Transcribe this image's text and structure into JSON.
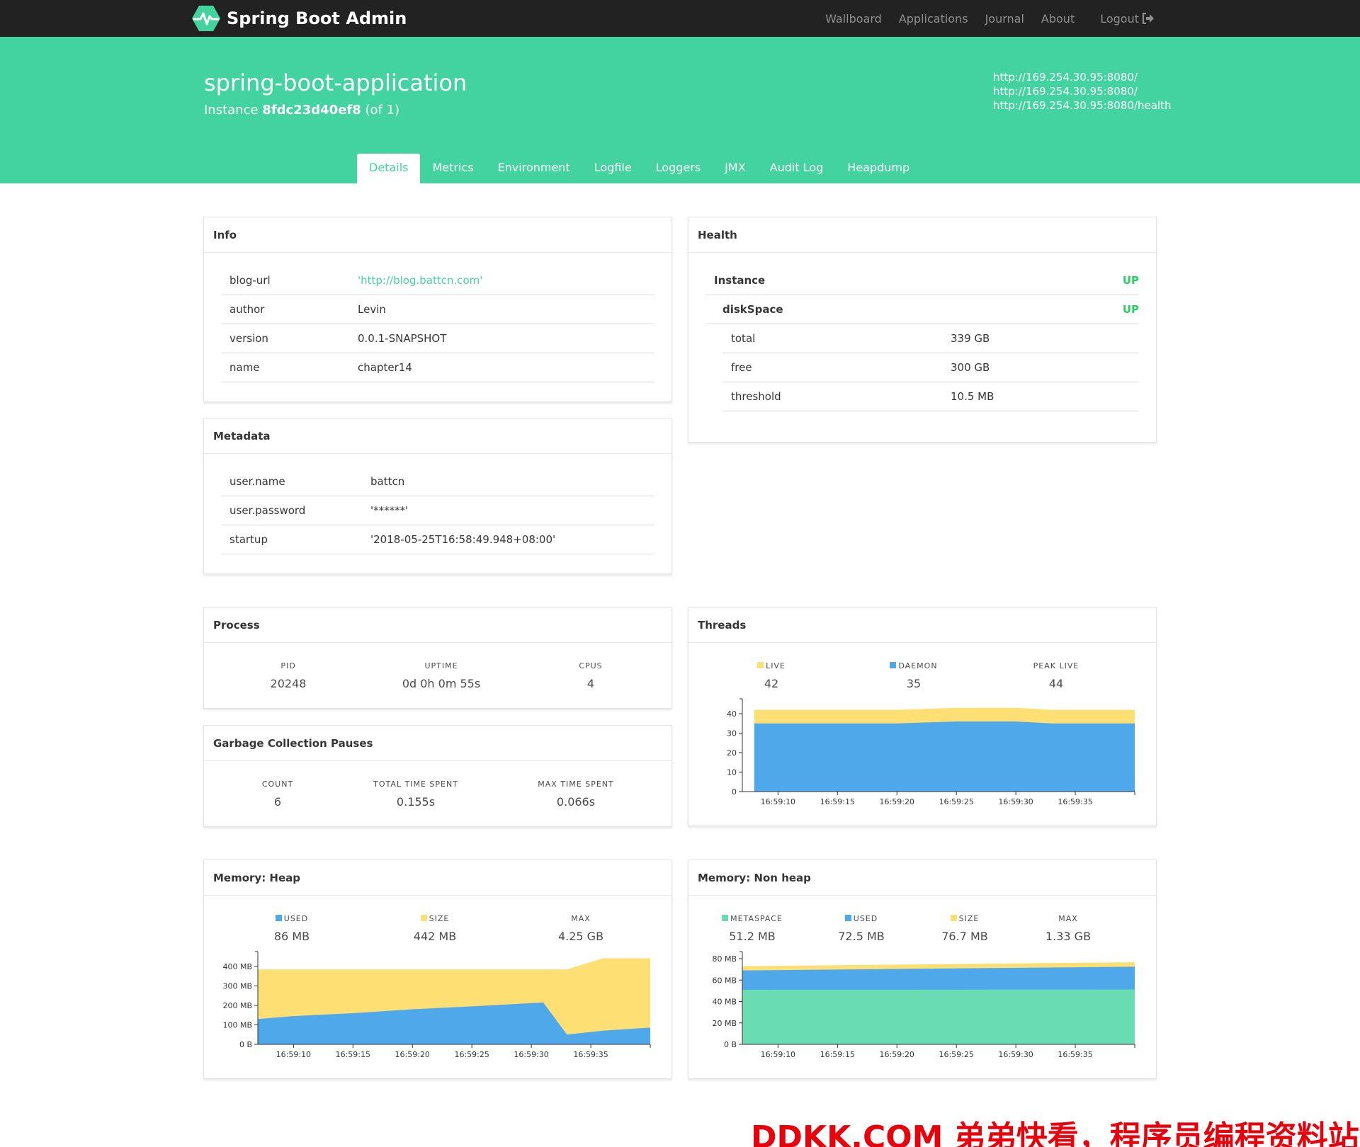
{
  "navbar": {
    "brand": "Spring Boot Admin",
    "links": [
      "Wallboard",
      "Applications",
      "Journal",
      "About"
    ],
    "logout": "Logout"
  },
  "app": {
    "name": "spring-boot-application",
    "instance_prefix": "Instance",
    "instance_id": "8fdc23d40ef8",
    "instance_suffix": "(of 1)",
    "urls": [
      "http://169.254.30.95:8080/",
      "http://169.254.30.95:8080/",
      "http://169.254.30.95:8080/health"
    ]
  },
  "tabs": [
    {
      "label": "Details",
      "active": true
    },
    {
      "label": "Metrics"
    },
    {
      "label": "Environment"
    },
    {
      "label": "Logfile"
    },
    {
      "label": "Loggers"
    },
    {
      "label": "JMX"
    },
    {
      "label": "Audit Log"
    },
    {
      "label": "Heapdump"
    }
  ],
  "info": {
    "title": "Info",
    "rows": [
      {
        "key": "blog-url",
        "value": "'http://blog.battcn.com'"
      },
      {
        "key": "author",
        "value": "Levin"
      },
      {
        "key": "version",
        "value": "0.0.1-SNAPSHOT"
      },
      {
        "key": "name",
        "value": "chapter14"
      }
    ]
  },
  "metadata": {
    "title": "Metadata",
    "rows": [
      {
        "key": "user.name",
        "value": "battcn"
      },
      {
        "key": "user.password",
        "value": "'******'"
      },
      {
        "key": "startup",
        "value": "'2018-05-25T16:58:49.948+08:00'"
      }
    ]
  },
  "health": {
    "title": "Health",
    "instance_label": "Instance",
    "instance_status": "UP",
    "disk_label": "diskSpace",
    "disk_status": "UP",
    "rows": [
      {
        "key": "total",
        "value": "339 GB"
      },
      {
        "key": "free",
        "value": "300 GB"
      },
      {
        "key": "threshold",
        "value": "10.5 MB"
      }
    ]
  },
  "process": {
    "title": "Process",
    "stats": [
      {
        "label": "PID",
        "value": "20248"
      },
      {
        "label": "UPTIME",
        "value": "0d 0h 0m 55s"
      },
      {
        "label": "CPUS",
        "value": "4"
      }
    ]
  },
  "gc": {
    "title": "Garbage Collection Pauses",
    "stats": [
      {
        "label": "COUNT",
        "value": "6"
      },
      {
        "label": "TOTAL TIME SPENT",
        "value": "0.155s"
      },
      {
        "label": "MAX TIME SPENT",
        "value": "0.066s"
      }
    ]
  },
  "threads": {
    "title": "Threads",
    "stats": [
      {
        "label": "LIVE",
        "value": "42"
      },
      {
        "label": "DAEMON",
        "value": "35"
      },
      {
        "label": "PEAK LIVE",
        "value": "44"
      }
    ]
  },
  "heap": {
    "title": "Memory: Heap",
    "stats": [
      {
        "label": "USED",
        "value": "86 MB"
      },
      {
        "label": "SIZE",
        "value": "442 MB"
      },
      {
        "label": "MAX",
        "value": "4.25 GB"
      }
    ]
  },
  "nonheap": {
    "title": "Memory: Non heap",
    "stats": [
      {
        "label": "METASPACE",
        "value": "51.2 MB"
      },
      {
        "label": "USED",
        "value": "72.5 MB"
      },
      {
        "label": "SIZE",
        "value": "76.7 MB"
      },
      {
        "label": "MAX",
        "value": "1.33 GB"
      }
    ]
  },
  "colors": {
    "primary": "#42d3a0",
    "navbar": "#222222",
    "up": "#23d160",
    "yellow": "#fddf73",
    "blue": "#4ea8ea",
    "green": "#69dcb4"
  },
  "chart_data": [
    {
      "id": "threads",
      "type": "area",
      "x": [
        "16:59:08",
        "16:59:20",
        "16:59:25",
        "16:59:30",
        "16:59:33",
        "16:59:40"
      ],
      "tick_labels": [
        "16:59:10",
        "16:59:15",
        "16:59:20",
        "16:59:25",
        "16:59:30",
        "16:59:35"
      ],
      "yticks": [
        "0",
        "10",
        "20",
        "30",
        "40"
      ],
      "ylim": [
        0,
        44
      ],
      "series": [
        {
          "name": "DAEMON",
          "color": "#4ea8ea",
          "values": [
            35,
            35,
            36,
            36,
            35,
            35
          ]
        },
        {
          "name": "LIVE",
          "color": "#fddf73",
          "values": [
            42,
            42,
            43,
            43,
            42,
            42
          ]
        }
      ]
    },
    {
      "id": "heap",
      "type": "area",
      "x": [
        "16:59:07",
        "16:59:10",
        "16:59:15",
        "16:59:20",
        "16:59:25",
        "16:59:31",
        "16:59:33",
        "16:59:36",
        "16:59:40"
      ],
      "tick_labels": [
        "16:59:10",
        "16:59:15",
        "16:59:20",
        "16:59:25",
        "16:59:30",
        "16:59:35"
      ],
      "yticks": [
        "0 B",
        "100 MB",
        "200 MB",
        "300 MB",
        "400 MB"
      ],
      "ylim": [
        0,
        440
      ],
      "series": [
        {
          "name": "USED",
          "color": "#4ea8ea",
          "values": [
            130,
            145,
            160,
            180,
            195,
            215,
            50,
            70,
            86
          ]
        },
        {
          "name": "SIZE",
          "color": "#fddf73",
          "values": [
            385,
            385,
            385,
            385,
            385,
            385,
            385,
            442,
            442
          ]
        }
      ]
    },
    {
      "id": "nonheap",
      "type": "area",
      "x": [
        "16:59:07",
        "16:59:40"
      ],
      "tick_labels": [
        "16:59:10",
        "16:59:15",
        "16:59:20",
        "16:59:25",
        "16:59:30",
        "16:59:35"
      ],
      "yticks": [
        "0 B",
        "20 MB",
        "40 MB",
        "60 MB",
        "80 MB"
      ],
      "ylim": [
        0,
        80
      ],
      "series": [
        {
          "name": "METASPACE",
          "color": "#69dcb4",
          "values": [
            51,
            51.2
          ]
        },
        {
          "name": "USED",
          "color": "#4ea8ea",
          "values": [
            69,
            72.5
          ]
        },
        {
          "name": "SIZE",
          "color": "#fddf73",
          "values": [
            73,
            76.7
          ]
        }
      ]
    }
  ],
  "watermark": "DDKK.COM 弟弟快看，程序员编程资料站"
}
